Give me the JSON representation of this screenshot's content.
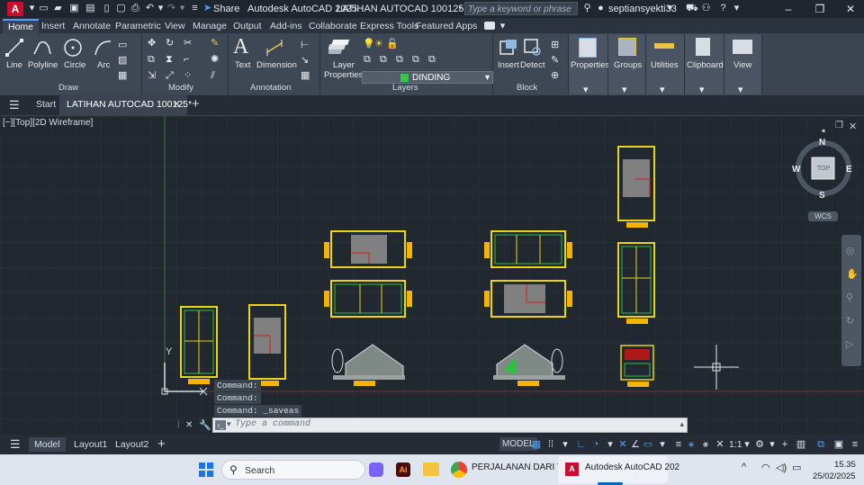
{
  "titlebar": {
    "logo": "A",
    "share": "Share",
    "app_title": "Autodesk AutoCAD 2025",
    "file_title": "LATIHAN AUTOCAD 100125.dwg",
    "search_placeholder": "Type a keyword or phrase",
    "username": "septiansyekti33"
  },
  "ribbon_tabs": [
    "Home",
    "Insert",
    "Annotate",
    "Parametric",
    "View",
    "Manage",
    "Output",
    "Add-ins",
    "Collaborate",
    "Express Tools",
    "Featured Apps"
  ],
  "draw": {
    "panel": "Draw",
    "line": "Line",
    "polyline": "Polyline",
    "circle": "Circle",
    "arc": "Arc"
  },
  "modify": {
    "panel": "Modify"
  },
  "annotation": {
    "panel": "Annotation",
    "text": "Text",
    "dimension": "Dimension"
  },
  "layers": {
    "panel": "Layers",
    "properties_line1": "Layer",
    "properties_line2": "Properties",
    "current_layer": "DINDING",
    "layer_color": "#2ecc40"
  },
  "block": {
    "panel": "Block",
    "insert": "Insert",
    "detect": "Detect"
  },
  "right_panels": {
    "properties": "Properties",
    "groups": "Groups",
    "utilities": "Utilities",
    "clipboard": "Clipboard",
    "view": "View"
  },
  "doc_tabs": {
    "start": "Start",
    "file": "LATIHAN AUTOCAD 100125*"
  },
  "viewport_label": "[−][Top][2D Wireframe]",
  "viewcube": {
    "n": "N",
    "s": "S",
    "e": "E",
    "w": "W",
    "top": "TOP",
    "wcs": "WCS"
  },
  "ucs": {
    "y": "Y"
  },
  "command_history": [
    "Command:",
    "Command:",
    "Command: _saveas"
  ],
  "command_placeholder": "Type a command",
  "layout_tabs": [
    "Model",
    "Layout1",
    "Layout2"
  ],
  "status": {
    "model": "MODEL",
    "scale": "1:1"
  },
  "taskbar": {
    "search": "Search",
    "item_chrome": "PERJALANAN DARI TOTO",
    "item_acad": "Autodesk AutoCAD 202",
    "time": "15.35",
    "date": "25/02/2025"
  }
}
